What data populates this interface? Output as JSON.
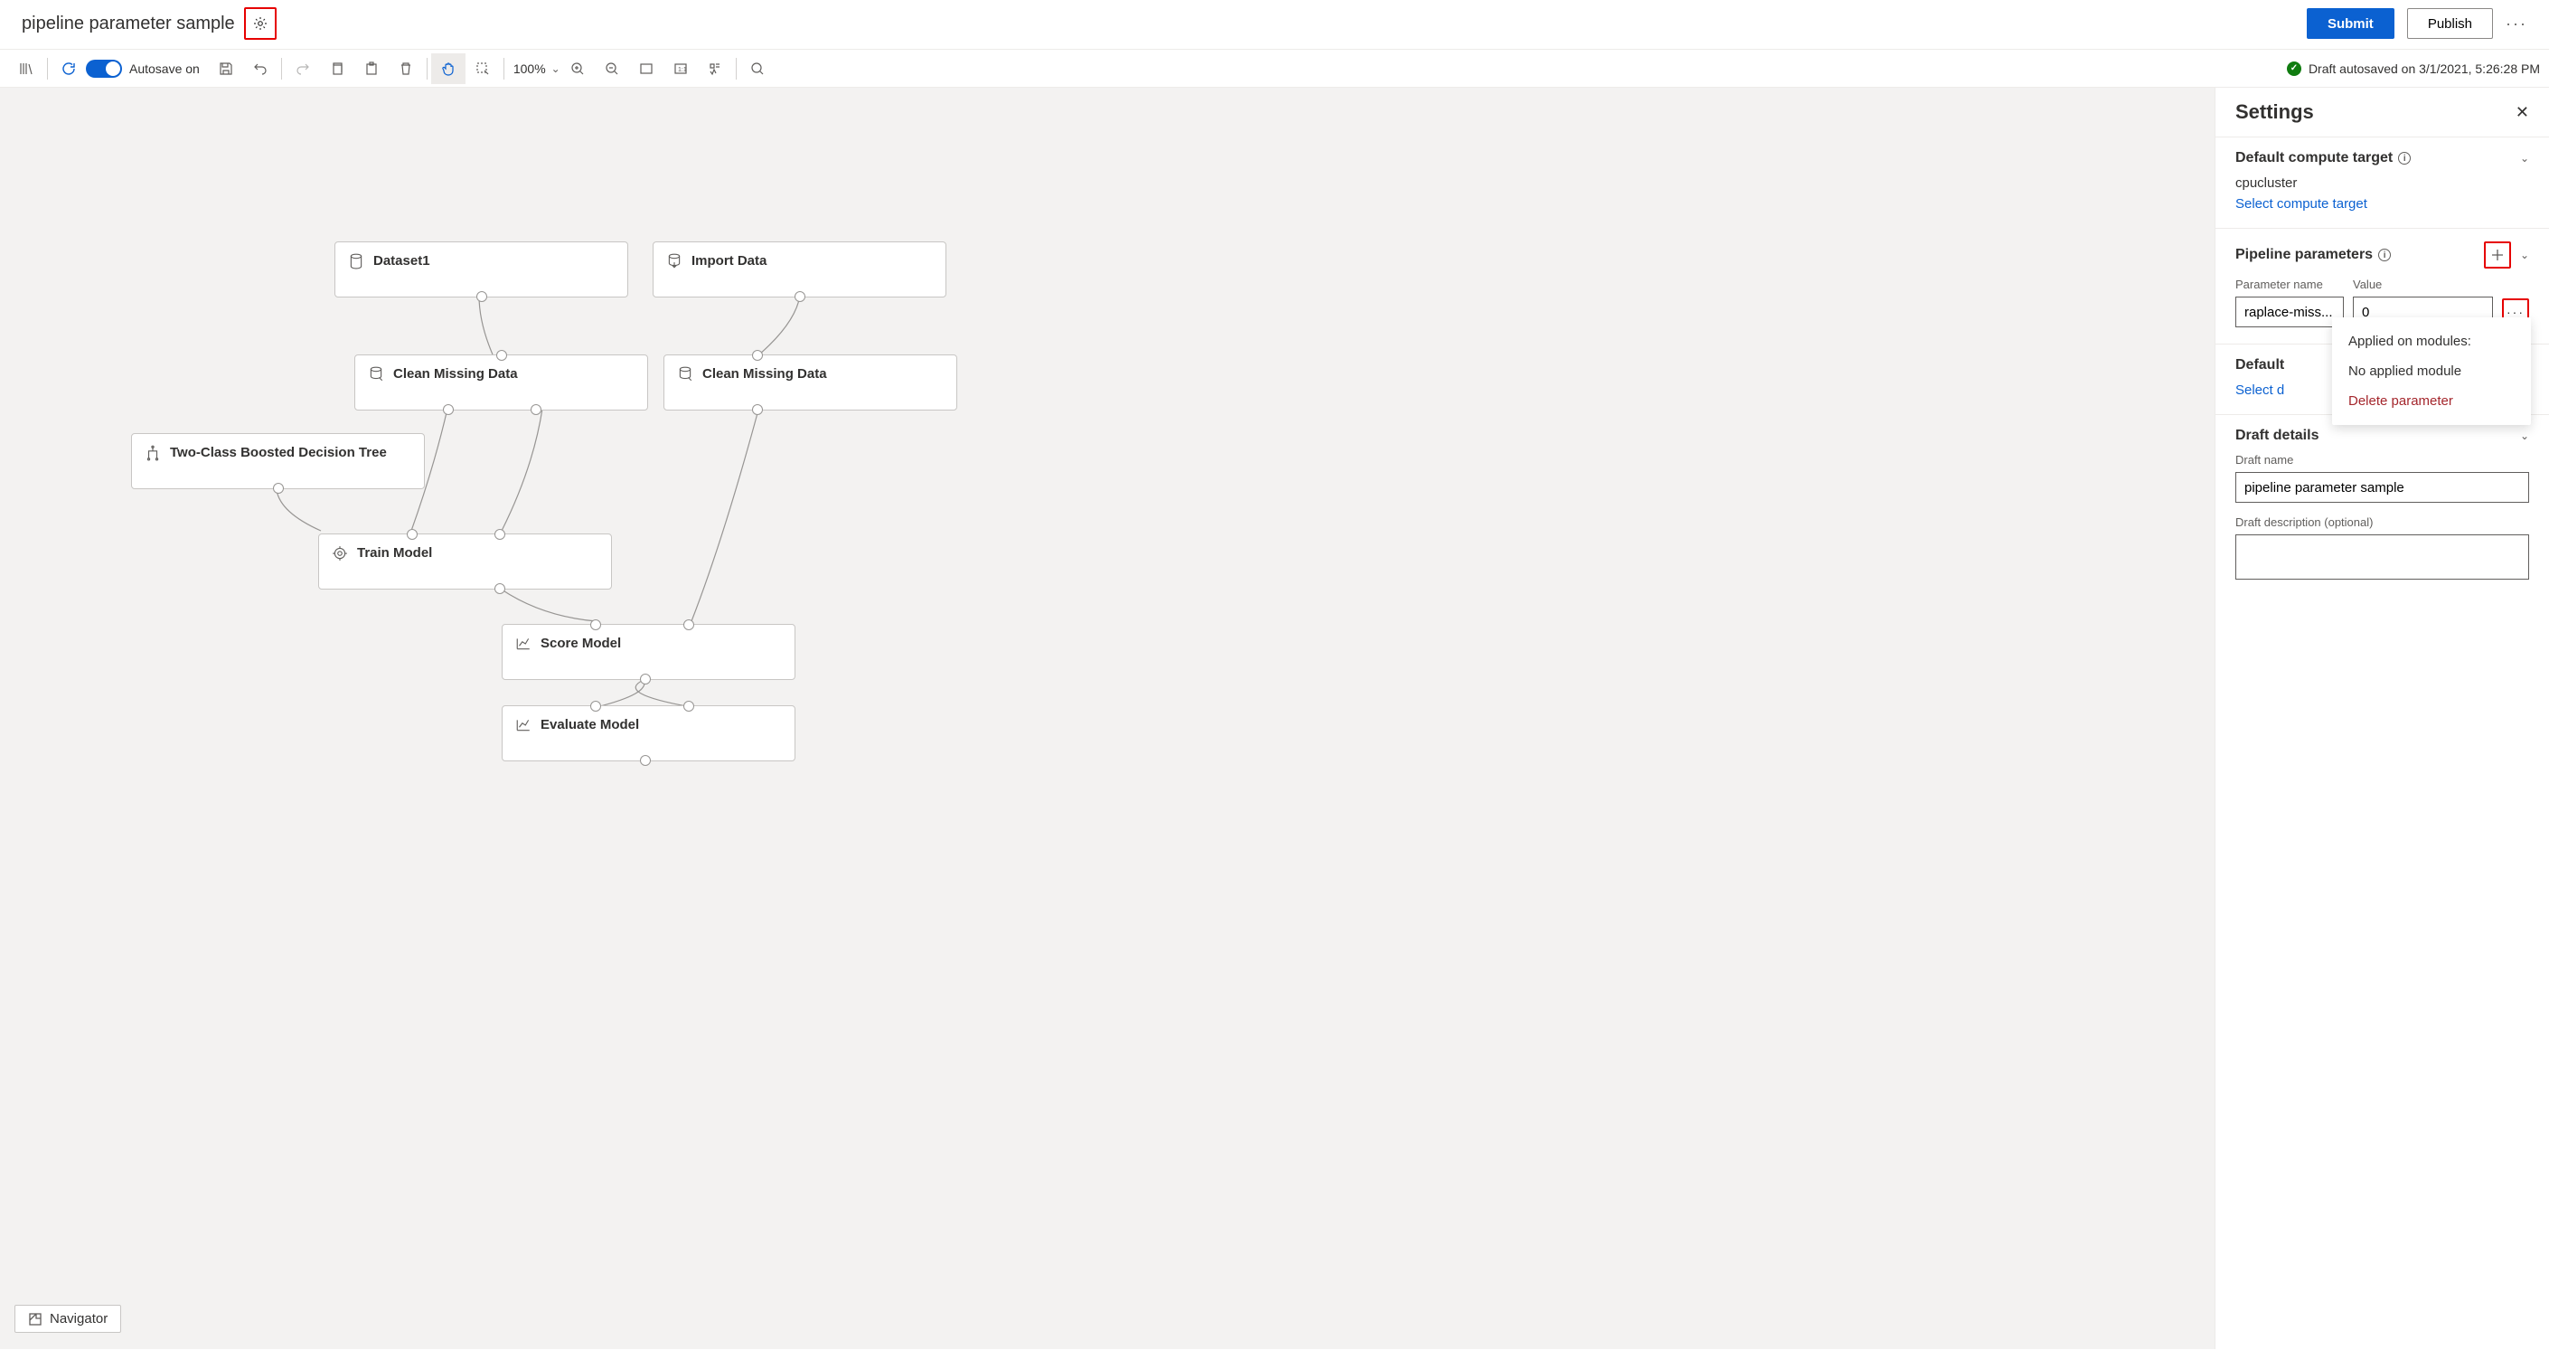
{
  "header": {
    "title": "pipeline parameter sample",
    "submit": "Submit",
    "publish": "Publish"
  },
  "toolbar": {
    "autosave": "Autosave on",
    "zoom": "100%",
    "status": "Draft autosaved on 3/1/2021, 5:26:28 PM"
  },
  "nodes": {
    "dataset1": "Dataset1",
    "import": "Import Data",
    "clean1": "Clean Missing Data",
    "clean2": "Clean Missing Data",
    "tree": "Two-Class Boosted Decision Tree",
    "train": "Train Model",
    "score": "Score Model",
    "eval": "Evaluate Model"
  },
  "navigator": "Navigator",
  "panel": {
    "title": "Settings",
    "compute": {
      "title": "Default compute target",
      "value": "cpucluster",
      "link": "Select compute target"
    },
    "params": {
      "title": "Pipeline parameters",
      "name_label": "Parameter name",
      "value_label": "Value",
      "name": "raplace-miss...",
      "value": "0",
      "popup_applied": "Applied on modules:",
      "popup_none": "No applied module",
      "popup_delete": "Delete parameter"
    },
    "datastore": {
      "title_preview": "Default",
      "link_preview": "Select d"
    },
    "draft": {
      "title": "Draft details",
      "name_label": "Draft name",
      "name": "pipeline parameter sample",
      "desc_label": "Draft description (optional)"
    }
  }
}
